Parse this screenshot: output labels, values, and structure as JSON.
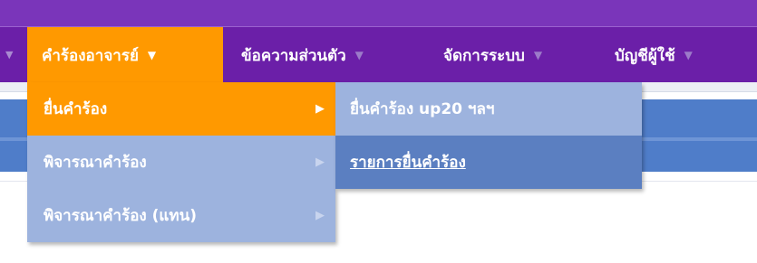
{
  "menubar": {
    "items": [
      {
        "label": "คำร้องอาจารย์"
      },
      {
        "label": "ข้อความส่วนตัว"
      },
      {
        "label": "จัดการระบบ"
      },
      {
        "label": "บัญชีผู้ใช้"
      }
    ],
    "caret": "▼",
    "lead_arrow": "▼"
  },
  "dropdown": {
    "items": [
      {
        "label": "ยื่นคำร้อง"
      },
      {
        "label": "พิจารณาคำร้อง"
      },
      {
        "label": "พิจารณาคำร้อง (แทน)"
      }
    ],
    "arrow": "▶"
  },
  "submenu": {
    "items": [
      {
        "label": "ยื่นคำร้อง up20 ฯลฯ"
      },
      {
        "label": "รายการยื่นคำร้อง"
      }
    ]
  },
  "colors": {
    "menubar": "#6b1fa8",
    "active": "#ff9900",
    "dropdown": "#9db3de",
    "hover": "#5b7fc1",
    "header_blue": "#4f7dc9"
  }
}
